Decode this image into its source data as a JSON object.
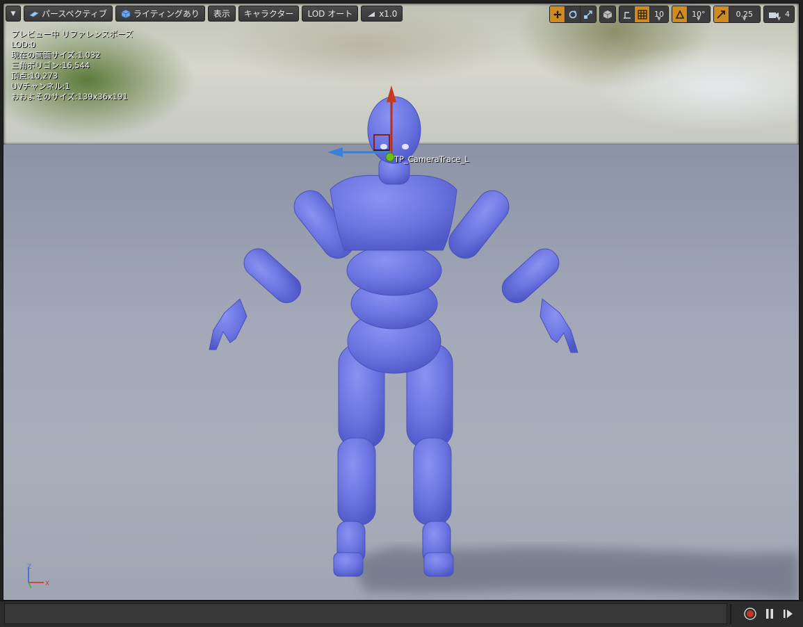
{
  "toolbar": {
    "menu_icon": "chevron-down-icon",
    "perspective_label": "パースペクティブ",
    "lighting_label": "ライティングあり",
    "show_label": "表示",
    "character_label": "キャラクター",
    "lod_label": "LOD オート",
    "speed_label": "x1.0",
    "grid_snap_value": "10",
    "rotation_snap_value": "10°",
    "scale_snap_value": "0.25",
    "camera_speed_value": "4"
  },
  "stats": {
    "preview_mode": "プレビュー中 リファレンスポーズ",
    "lod": "LOD:0",
    "screen_size": "現在の画面サイズ:1.032",
    "triangles": "三角ポリゴン:16,544",
    "vertices": "頂点:10,273",
    "uv_channels": "UVチャンネル:1",
    "approx_size": "おおよそのサイズ:139x36x191"
  },
  "viewport": {
    "socket_label": "TP_CameraTrace_L",
    "axis_z": "Z",
    "axis_x": "X",
    "axis_y": "Y"
  },
  "colors": {
    "accent": "#d08a1f",
    "mannequin": "#6a74e0",
    "gizmo_x": "#b8321a",
    "gizmo_y": "#3a7fd8",
    "gizmo_center": "#6fbf1a"
  }
}
